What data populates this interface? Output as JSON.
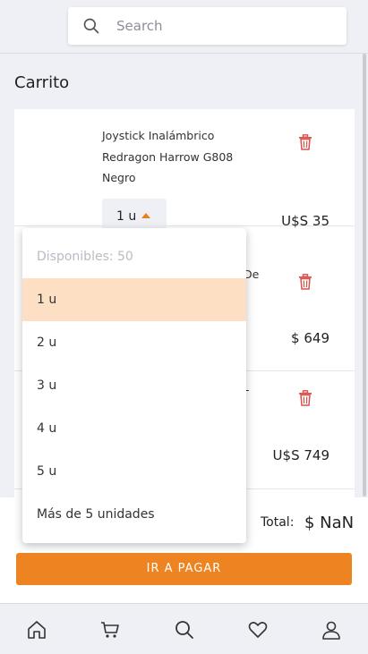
{
  "search": {
    "placeholder": "Search"
  },
  "page": {
    "title": "Carrito"
  },
  "cart": {
    "items": [
      {
        "name_lines": [
          "Joystick Inalámbrico",
          "Redragon Harrow G808",
          "Negro"
        ],
        "quantity": "1 u",
        "price": "U$S 35"
      },
      {
        "name_lines": [
          "De"
        ],
        "price": "$ 649"
      },
      {
        "name_lines": [
          "-"
        ],
        "price": "U$S 749"
      }
    ]
  },
  "dropdown": {
    "header": "Disponibles: 50",
    "options": [
      "1 u",
      "2 u",
      "3 u",
      "4 u",
      "5 u",
      "Más de 5 unidades"
    ],
    "selected_index": 0
  },
  "summary": {
    "total_label": "Total:",
    "total_value": "$ NaN",
    "pay_label": "IR A PAGAR"
  },
  "colors": {
    "accent": "#ee8421",
    "selected_bg": "#fde0c4",
    "trash": "#d9534f"
  },
  "nav": {
    "icons": [
      "home-icon",
      "cart-icon",
      "search-icon",
      "heart-icon",
      "user-icon"
    ]
  }
}
